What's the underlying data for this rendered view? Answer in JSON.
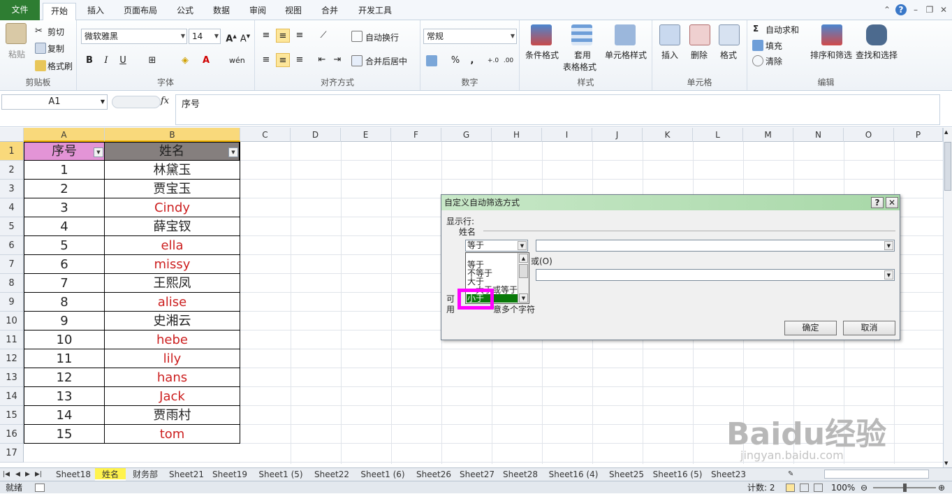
{
  "ribbon_tabs": [
    "文件",
    "开始",
    "插入",
    "页面布局",
    "公式",
    "数据",
    "审阅",
    "视图",
    "合并",
    "开发工具"
  ],
  "clipboard": {
    "paste": "粘贴",
    "cut": "剪切",
    "copy": "复制",
    "format_painter": "格式刷",
    "label": "剪贴板"
  },
  "font": {
    "name": "微软雅黑",
    "size": "14",
    "bold": "B",
    "italic": "I",
    "underline": "U",
    "label": "字体"
  },
  "alignment": {
    "wrap": "自动换行",
    "merge": "合并后居中",
    "label": "对齐方式"
  },
  "number": {
    "format": "常规",
    "percent": "%",
    "comma": ",",
    "label": "数字"
  },
  "styles": {
    "conditional": "条件格式",
    "table1": "套用",
    "table2": "表格格式",
    "cell_styles": "单元格样式",
    "label": "样式"
  },
  "cells": {
    "insert": "插入",
    "delete": "删除",
    "format": "格式",
    "label": "单元格"
  },
  "editing": {
    "autosum": "自动求和",
    "fill": "填充",
    "clear": "清除",
    "sort": "排序和筛选",
    "find": "查找和选择",
    "label": "编辑"
  },
  "formula_bar": {
    "name_box": "A1",
    "fx": "fx",
    "content": "序号"
  },
  "columns": [
    "A",
    "B",
    "C",
    "D",
    "E",
    "F",
    "G",
    "H",
    "I",
    "J",
    "K",
    "L",
    "M",
    "N",
    "O",
    "P"
  ],
  "rows": [
    "1",
    "2",
    "3",
    "4",
    "5",
    "6",
    "7",
    "8",
    "9",
    "10",
    "11",
    "12",
    "13",
    "14",
    "15",
    "16",
    "17"
  ],
  "header": {
    "a": "序号",
    "b": "姓名"
  },
  "data": [
    {
      "n": "1",
      "name": "林黛玉",
      "red": false
    },
    {
      "n": "2",
      "name": "贾宝玉",
      "red": false
    },
    {
      "n": "3",
      "name": "Cindy",
      "red": true
    },
    {
      "n": "4",
      "name": "薛宝钗",
      "red": false
    },
    {
      "n": "5",
      "name": "ella",
      "red": true
    },
    {
      "n": "6",
      "name": "missy",
      "red": true
    },
    {
      "n": "7",
      "name": "王熙凤",
      "red": false
    },
    {
      "n": "8",
      "name": "alise",
      "red": true
    },
    {
      "n": "9",
      "name": "史湘云",
      "red": false
    },
    {
      "n": "10",
      "name": "hebe",
      "red": true
    },
    {
      "n": "11",
      "name": "lily",
      "red": true
    },
    {
      "n": "12",
      "name": "hans",
      "red": true
    },
    {
      "n": "13",
      "name": "Jack",
      "red": true
    },
    {
      "n": "14",
      "name": "贾雨村",
      "red": false
    },
    {
      "n": "15",
      "name": "tom",
      "red": true
    }
  ],
  "dialog": {
    "title": "自定义自动筛选方式",
    "help": "?",
    "close": "✕",
    "show_rows": "显示行:",
    "field": "姓名",
    "op1": "等于",
    "or": "或(O)",
    "hint_a": "可",
    "hint_b": "用",
    "hint_tail": "意多个字符",
    "ok": "确定",
    "cancel": "取消",
    "list_items": [
      "等于",
      "不等于",
      "大于",
      "大于或等于",
      "小于"
    ]
  },
  "sheet_tabs": [
    "Sheet18",
    "姓名",
    "财务部",
    "Sheet21",
    "Sheet19",
    "Sheet1 (5)",
    "Sheet22",
    "Sheet1 (6)",
    "Sheet26",
    "Sheet27",
    "Sheet28",
    "Sheet16 (4)",
    "Sheet25",
    "Sheet16 (5)",
    "Sheet23"
  ],
  "active_sheet": "姓名",
  "status": {
    "ready": "就绪",
    "count": "计数: 2",
    "zoom": "100%"
  },
  "watermark": {
    "brand": "Baidu经验",
    "url": "jingyan.baidu.com"
  },
  "colors": {
    "file_tab": "#2e7d32",
    "header_a": "#e394d6",
    "header_b": "#857f7e",
    "dialog_title": "#a8d8a8",
    "highlight": "#ff00ff",
    "list_sel": "#0a7a0a",
    "red_text": "#cc1f1f"
  }
}
